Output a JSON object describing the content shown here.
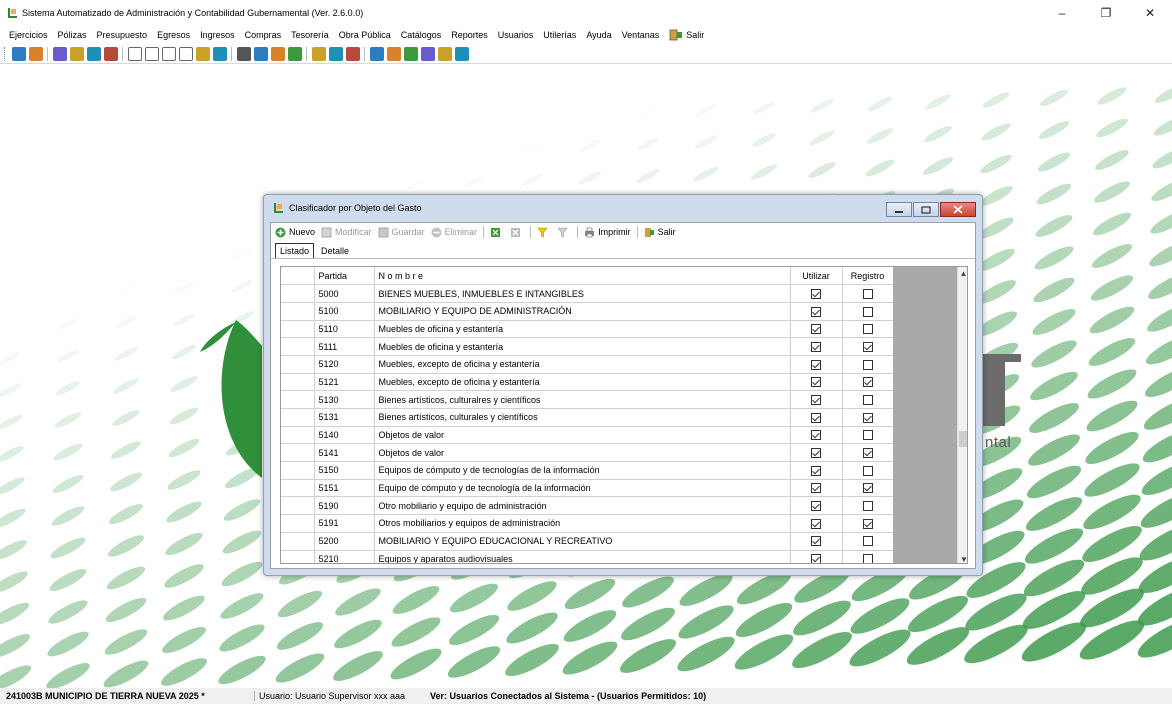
{
  "window": {
    "title": "Sistema Automatizado de Administración y Contabilidad Gubernamental  (Ver. 2.6.0.0)",
    "minimize": "–",
    "restore": "❐",
    "close": "✕"
  },
  "menu": [
    "Ejercicios",
    "Pólizas",
    "Presupuesto",
    "Egresos",
    "Ingresos",
    "Compras",
    "Tesorería",
    "Obra Pública",
    "Catálogos",
    "Reportes",
    "Usuarios",
    "Utilerías",
    "Ayuda",
    "Ventanas",
    "Salir"
  ],
  "toolbar_icons": [
    "refresh-icon",
    "report-icon",
    "sep",
    "users-icon",
    "transfer-icon",
    "calendar-icon",
    "grid-icon",
    "sep",
    "c-icon",
    "d-icon",
    "e-icon",
    "p-icon",
    "book-icon",
    "print-icon",
    "sep",
    "clipboard-icon",
    "edit-icon",
    "chart-icon",
    "box-icon",
    "sep",
    "document-icon",
    "tools-icon",
    "globe-icon",
    "sep",
    "tree-icon",
    "config-icon",
    "search-icon",
    "help-book-icon",
    "save-icon",
    "help-icon"
  ],
  "colors": {
    "accent_green": "#3c9a3c",
    "dialog_frame": "#cfdced",
    "close_red": "#c34a34",
    "grid_gray": "#a9a9a9"
  },
  "dialog": {
    "title": "Clasificador por Objeto del Gasto",
    "toolbar": {
      "nuevo": "Nuevo",
      "modificar": "Modificar",
      "guardar": "Guardar",
      "eliminar": "Eliminar",
      "imprimir": "Imprimir",
      "salir": "Salir"
    },
    "tabs": [
      "Listado",
      "Detalle"
    ],
    "columns": {
      "partida": "Partida",
      "nombre": "N o m b r e",
      "utilizar": "Utilizar",
      "registro": "Registro"
    },
    "rows": [
      {
        "partida": "5000",
        "nombre": "BIENES MUEBLES, INMUEBLES E INTANGIBLES",
        "utilizar": true,
        "registro": false
      },
      {
        "partida": "5100",
        "nombre": "MOBILIARIO Y EQUIPO DE ADMINISTRACIÓN",
        "utilizar": true,
        "registro": false
      },
      {
        "partida": "5110",
        "nombre": "Muebles de oficina y estantería",
        "utilizar": true,
        "registro": false
      },
      {
        "partida": "5111",
        "nombre": "Muebles de oficina y estantería",
        "utilizar": true,
        "registro": true
      },
      {
        "partida": "5120",
        "nombre": "Muebles, excepto de oficina y estantería",
        "utilizar": true,
        "registro": false
      },
      {
        "partida": "5121",
        "nombre": "Muebles, excepto de oficina y estantería",
        "utilizar": true,
        "registro": true
      },
      {
        "partida": "5130",
        "nombre": "Bienes artísticos, culturalres y científicos",
        "utilizar": true,
        "registro": false
      },
      {
        "partida": "5131",
        "nombre": "Bienes artísticos, culturales y científicos",
        "utilizar": true,
        "registro": true
      },
      {
        "partida": "5140",
        "nombre": "Objetos de valor",
        "utilizar": true,
        "registro": false
      },
      {
        "partida": "5141",
        "nombre": "Objetos de valor",
        "utilizar": true,
        "registro": true
      },
      {
        "partida": "5150",
        "nombre": "Equipos de cómputo y de tecnologías de la información",
        "utilizar": true,
        "registro": false
      },
      {
        "partida": "5151",
        "nombre": "Equipo de cómputo y de tecnología de la información",
        "utilizar": true,
        "registro": true
      },
      {
        "partida": "5190",
        "nombre": "Otro mobiliario y equipo de administración",
        "utilizar": true,
        "registro": false
      },
      {
        "partida": "5191",
        "nombre": "Otros mobiliarios y equipos de administración",
        "utilizar": true,
        "registro": true
      },
      {
        "partida": "5200",
        "nombre": "MOBILIARIO Y EQUIPO EDUCACIONAL Y RECREATIVO",
        "utilizar": true,
        "registro": false
      },
      {
        "partida": "5210",
        "nombre": "Equipos y aparatos audiovisuales",
        "utilizar": true,
        "registro": false
      }
    ]
  },
  "background": {
    "logo_fragment_text": "ntal"
  },
  "status": {
    "company": "241003B MUNICIPIO DE TIERRA NUEVA  2025  *",
    "user": "Usuario: Usuario Supervisor xxx aaa",
    "version": "Ver: Usuarios Conectados al Sistema - (Usuarios Permitidos: 10)"
  }
}
